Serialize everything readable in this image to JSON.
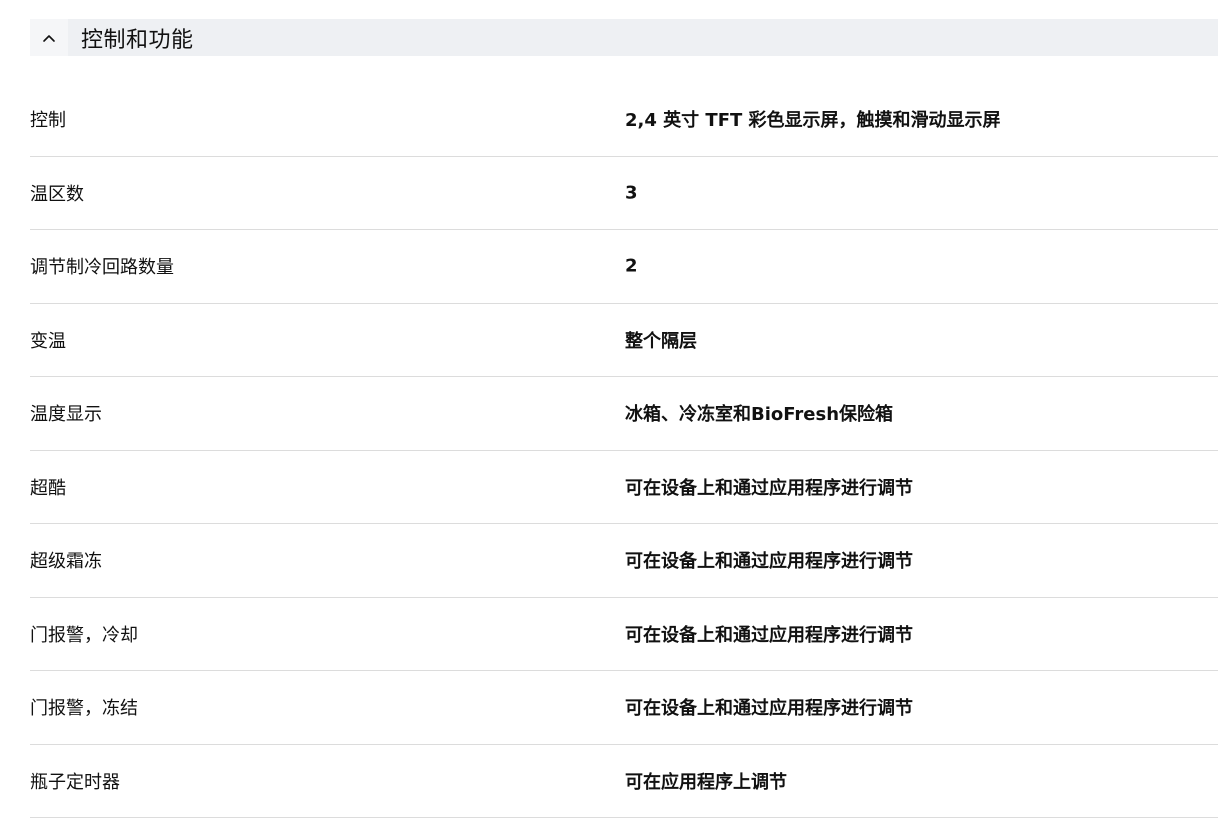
{
  "section": {
    "title": "控制和功能",
    "chevron_icon": "chevron-up-icon",
    "expanded": true
  },
  "specs": [
    {
      "label": "控制",
      "value": "2,4 英寸 TFT 彩色显示屏，触摸和滑动显示屏"
    },
    {
      "label": "温区数",
      "value": "3"
    },
    {
      "label": "调节制冷回路数量",
      "value": "2"
    },
    {
      "label": "变温",
      "value": "整个隔层"
    },
    {
      "label": "温度显示",
      "value": "冰箱、冷冻室和BioFresh保险箱"
    },
    {
      "label": "超酷",
      "value": "可在设备上和通过应用程序进行调节"
    },
    {
      "label": "超级霜冻",
      "value": "可在设备上和通过应用程序进行调节"
    },
    {
      "label": "门报警，冷却",
      "value": "可在设备上和通过应用程序进行调节"
    },
    {
      "label": "门报警，冻结",
      "value": "可在设备上和通过应用程序进行调节"
    },
    {
      "label": "瓶子定时器",
      "value": "可在应用程序上调节"
    }
  ],
  "colors": {
    "header_bg": "#eef0f3",
    "divider": "#dcdcdc",
    "text": "#111111"
  }
}
